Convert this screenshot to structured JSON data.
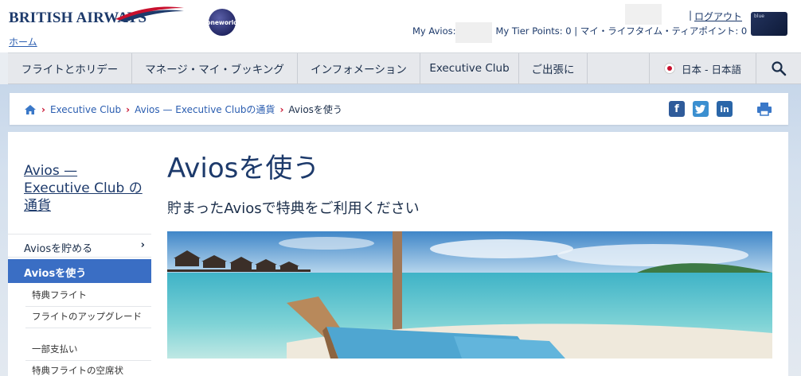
{
  "header": {
    "brand": "BRITISH AIRWAYS",
    "home_link": "ホーム",
    "alliance": "oneworld",
    "logout": "ログアウト",
    "avios_label": "My Avios:",
    "points_rest": "My Tier Points: 0 | マイ・ライフタイム・ティアポイント: 0",
    "card_label": "blue"
  },
  "nav": {
    "items": [
      "フライトとホリデー",
      "マネージ・マイ・ブッキング",
      "インフォメーション",
      "Executive Club",
      "ご出張に"
    ],
    "language": "日本 - 日本語"
  },
  "breadcrumb": {
    "items": [
      "Executive Club",
      "Avios — Executive Clubの通貨"
    ],
    "current": "Aviosを使う"
  },
  "sidebar": {
    "title": "Avios — Executive Club の通貨",
    "earn": "Aviosを貯める",
    "use": "Aviosを使う",
    "sub_items": [
      "特典フライト",
      "フライトのアップグレード",
      "一部支払い",
      "特典フライトの空席状"
    ]
  },
  "main": {
    "title": "Aviosを使う",
    "subtitle": "貯まったAviosで特典をご利用ください"
  },
  "colors": {
    "brand_navy": "#1d3a6b",
    "accent_red": "#c8102e",
    "active_blue": "#3a6ec4",
    "link_blue": "#2a5db0"
  }
}
